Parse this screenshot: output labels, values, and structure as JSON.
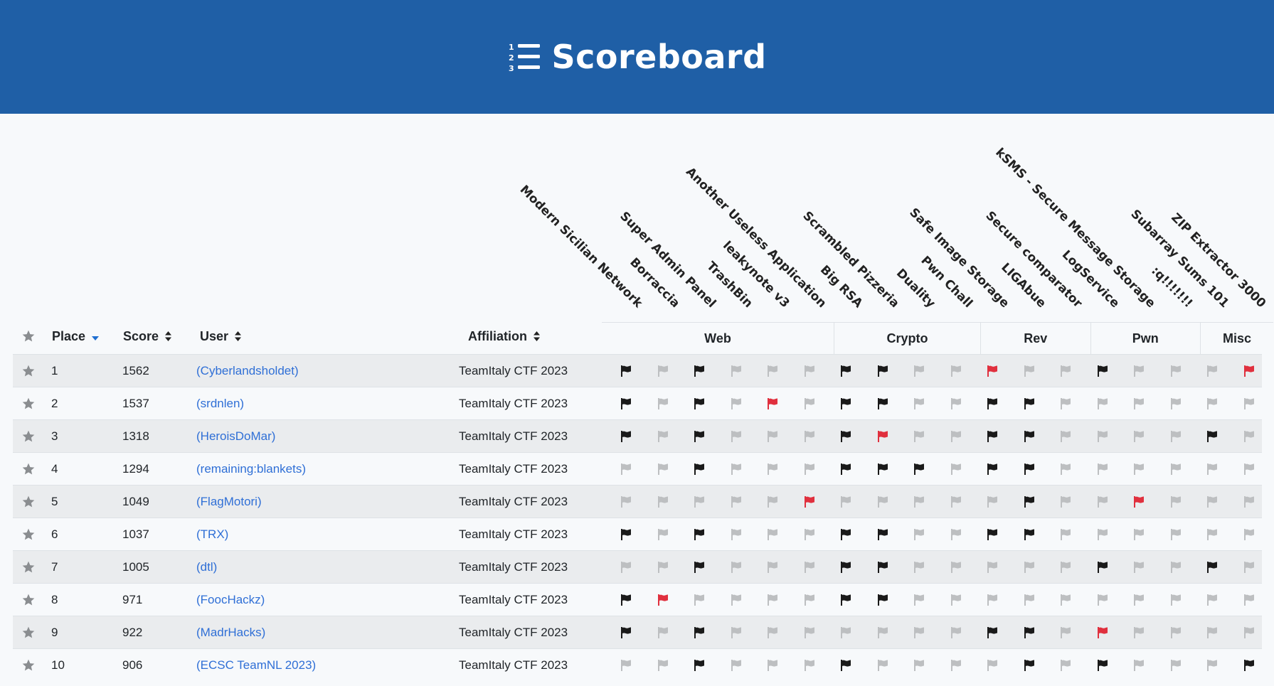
{
  "header": {
    "title": "Scoreboard",
    "icon": "list-numbered-icon"
  },
  "columns": {
    "place": "Place",
    "score": "Score",
    "user": "User",
    "affiliation": "Affiliation"
  },
  "categories": [
    {
      "name": "Web",
      "count": 6
    },
    {
      "name": "Crypto",
      "count": 4
    },
    {
      "name": "Rev",
      "count": 3
    },
    {
      "name": "Pwn",
      "count": 3
    },
    {
      "name": "Misc",
      "count": 2
    }
  ],
  "challenges": [
    "Modern Sicilian Network",
    "Borraccia",
    "Super Admin Panel",
    "TrashBin",
    "leakynote v3",
    "Another Useless Application",
    "Big RSA",
    "Scrambled Pizzeria",
    "Duality",
    "Pwn Chall",
    "Safe Image Storage",
    "LIGAbue",
    "Secure comparator",
    "LogService",
    "kSMS - Secure Message Storage",
    ":q!!!!!!!",
    "Subarray Sums 101",
    "ZIP Extractor 3000"
  ],
  "colors": {
    "solved": "#1a1a1a",
    "unsolved": "#bdbfc1",
    "first_blood": "#e0303e",
    "header_bg": "#1f5fa6",
    "link": "#2f6fd6"
  },
  "rows": [
    {
      "place": "1",
      "score": "1562",
      "user": "(Cyberlandsholdet)",
      "affiliation": "TeamItaly CTF 2023",
      "flags": [
        "s",
        "u",
        "s",
        "u",
        "u",
        "u",
        "s",
        "s",
        "u",
        "u",
        "f",
        "u",
        "u",
        "s",
        "u",
        "u",
        "u",
        "f"
      ]
    },
    {
      "place": "2",
      "score": "1537",
      "user": "(srdnlen)",
      "affiliation": "TeamItaly CTF 2023",
      "flags": [
        "s",
        "u",
        "s",
        "u",
        "f",
        "u",
        "s",
        "s",
        "u",
        "u",
        "s",
        "s",
        "u",
        "u",
        "u",
        "u",
        "u",
        "u"
      ]
    },
    {
      "place": "3",
      "score": "1318",
      "user": "(HeroisDoMar)",
      "affiliation": "TeamItaly CTF 2023",
      "flags": [
        "s",
        "u",
        "s",
        "u",
        "u",
        "u",
        "s",
        "f",
        "u",
        "u",
        "s",
        "s",
        "u",
        "u",
        "u",
        "u",
        "s",
        "u"
      ]
    },
    {
      "place": "4",
      "score": "1294",
      "user": "(remaining:blankets)",
      "affiliation": "TeamItaly CTF 2023",
      "flags": [
        "u",
        "u",
        "s",
        "u",
        "u",
        "u",
        "s",
        "s",
        "s",
        "u",
        "s",
        "s",
        "u",
        "u",
        "u",
        "u",
        "u",
        "u"
      ]
    },
    {
      "place": "5",
      "score": "1049",
      "user": "(FlagMotori)",
      "affiliation": "TeamItaly CTF 2023",
      "flags": [
        "u",
        "u",
        "u",
        "u",
        "u",
        "f",
        "u",
        "u",
        "u",
        "u",
        "u",
        "s",
        "u",
        "u",
        "f",
        "u",
        "u",
        "u"
      ]
    },
    {
      "place": "6",
      "score": "1037",
      "user": "(TRX)",
      "affiliation": "TeamItaly CTF 2023",
      "flags": [
        "s",
        "u",
        "s",
        "u",
        "u",
        "u",
        "s",
        "s",
        "u",
        "u",
        "s",
        "s",
        "u",
        "u",
        "u",
        "u",
        "u",
        "u"
      ]
    },
    {
      "place": "7",
      "score": "1005",
      "user": "(dtl)",
      "affiliation": "TeamItaly CTF 2023",
      "flags": [
        "u",
        "u",
        "s",
        "u",
        "u",
        "u",
        "s",
        "s",
        "u",
        "u",
        "u",
        "u",
        "u",
        "s",
        "u",
        "u",
        "s",
        "u"
      ]
    },
    {
      "place": "8",
      "score": "971",
      "user": "(FoocHackz)",
      "affiliation": "TeamItaly CTF 2023",
      "flags": [
        "s",
        "f",
        "u",
        "u",
        "u",
        "u",
        "s",
        "s",
        "u",
        "u",
        "u",
        "u",
        "u",
        "u",
        "u",
        "u",
        "u",
        "u"
      ]
    },
    {
      "place": "9",
      "score": "922",
      "user": "(MadrHacks)",
      "affiliation": "TeamItaly CTF 2023",
      "flags": [
        "s",
        "u",
        "s",
        "u",
        "u",
        "u",
        "u",
        "u",
        "u",
        "u",
        "s",
        "s",
        "u",
        "f",
        "u",
        "u",
        "u",
        "u"
      ]
    },
    {
      "place": "10",
      "score": "906",
      "user": "(ECSC TeamNL 2023)",
      "affiliation": "TeamItaly CTF 2023",
      "flags": [
        "u",
        "u",
        "s",
        "u",
        "u",
        "u",
        "s",
        "u",
        "u",
        "u",
        "u",
        "s",
        "u",
        "s",
        "u",
        "u",
        "u",
        "s"
      ]
    }
  ]
}
